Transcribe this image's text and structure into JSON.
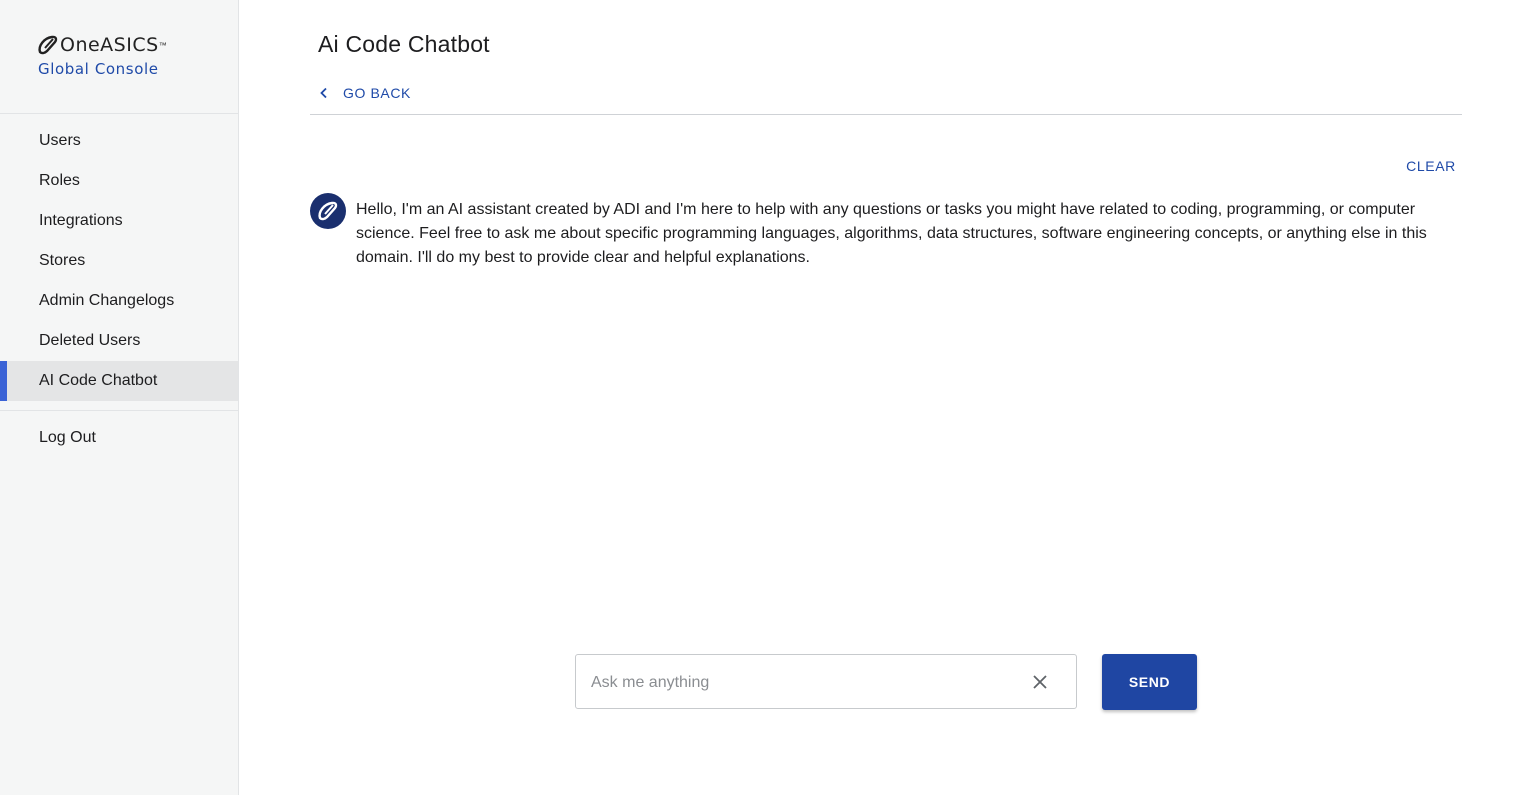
{
  "brand": {
    "name": "OneASICS",
    "trademark": "™",
    "subtitle": "Global Console"
  },
  "sidebar": {
    "items": [
      {
        "label": "Users",
        "active": false
      },
      {
        "label": "Roles",
        "active": false
      },
      {
        "label": "Integrations",
        "active": false
      },
      {
        "label": "Stores",
        "active": false
      },
      {
        "label": "Admin Changelogs",
        "active": false
      },
      {
        "label": "Deleted Users",
        "active": false
      },
      {
        "label": "AI Code Chatbot",
        "active": true
      }
    ],
    "logout_label": "Log Out"
  },
  "main": {
    "title": "Ai Code Chatbot",
    "go_back_label": "GO BACK",
    "clear_label": "CLEAR",
    "messages": [
      {
        "sender": "assistant",
        "text": "Hello, I'm an AI assistant created by ADI and I'm here to help with any questions or tasks you might have related to coding, programming, or computer science. Feel free to ask me about specific programming languages, algorithms, data structures, software engineering concepts, or anything else in this domain. I'll do my best to provide clear and helpful explanations."
      }
    ],
    "input": {
      "placeholder": "Ask me anything",
      "value": ""
    },
    "send_label": "SEND"
  },
  "colors": {
    "accent": "#1f4aa8",
    "active_indicator": "#3b63d6",
    "avatar_bg": "#1a2f6e",
    "send_bg": "#1f46a3"
  },
  "icons": {
    "back": "chevron-left-icon",
    "clear_input": "close-icon",
    "avatar": "asics-stripe-icon",
    "brand": "asics-stripe-icon"
  }
}
